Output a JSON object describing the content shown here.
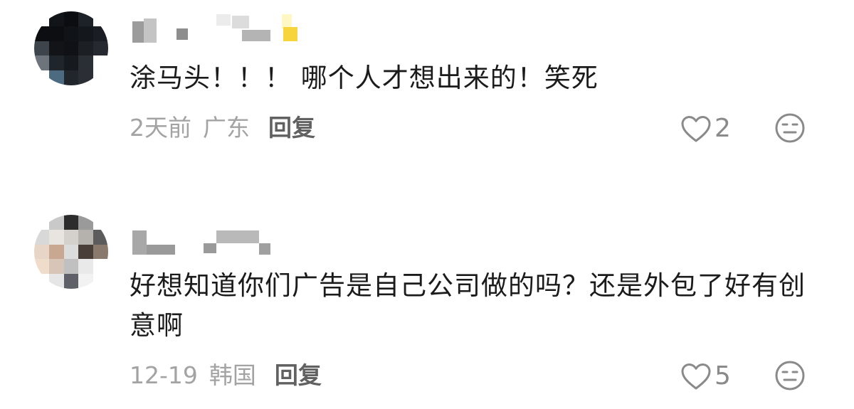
{
  "comments": [
    {
      "content": "涂马头！！！ 哪个人才想出来的！笑死",
      "date": "2天前",
      "region": "广东",
      "reply_label": "回复",
      "likes": "2",
      "avatar_colors": [
        "#ffffff",
        "#111418",
        "#0c0d10",
        "#1d2228",
        "#ffffff",
        "#0c0e12",
        "#0d0e12",
        "#101317",
        "#14171c",
        "#1a1e24",
        "#3e444c",
        "#121418",
        "#0f1116",
        "#1c1f24",
        "#262a30",
        "#6e747c",
        "#20252b",
        "#16191e",
        "#2a2f36",
        "#ffffff",
        "#ffffff",
        "#4c6a80",
        "#20262c",
        "#2b2f35",
        "#ffffff"
      ]
    },
    {
      "content": "好想知道你们广告是自己公司做的吗？还是外包了好有创意啊",
      "date": "12-19",
      "region": "韩国",
      "reply_label": "回复",
      "likes": "5",
      "avatar_colors": [
        "#ffffff",
        "#c9c9c9",
        "#2c2c2c",
        "#9a9a9a",
        "#ffffff",
        "#d8d8d8",
        "#e8e4df",
        "#d4d0cb",
        "#b5b1ac",
        "#5c5c5c",
        "#e7d6c8",
        "#c8a890",
        "#dcdcdc",
        "#4a3f38",
        "#8a7a6e",
        "#f0dccb",
        "#d7c6b8",
        "#c0c0c0",
        "#e9e9e9",
        "#ffffff",
        "#ffffff",
        "#e6e6e6",
        "#5e6268",
        "#f2f2f2",
        "#ffffff"
      ]
    }
  ]
}
